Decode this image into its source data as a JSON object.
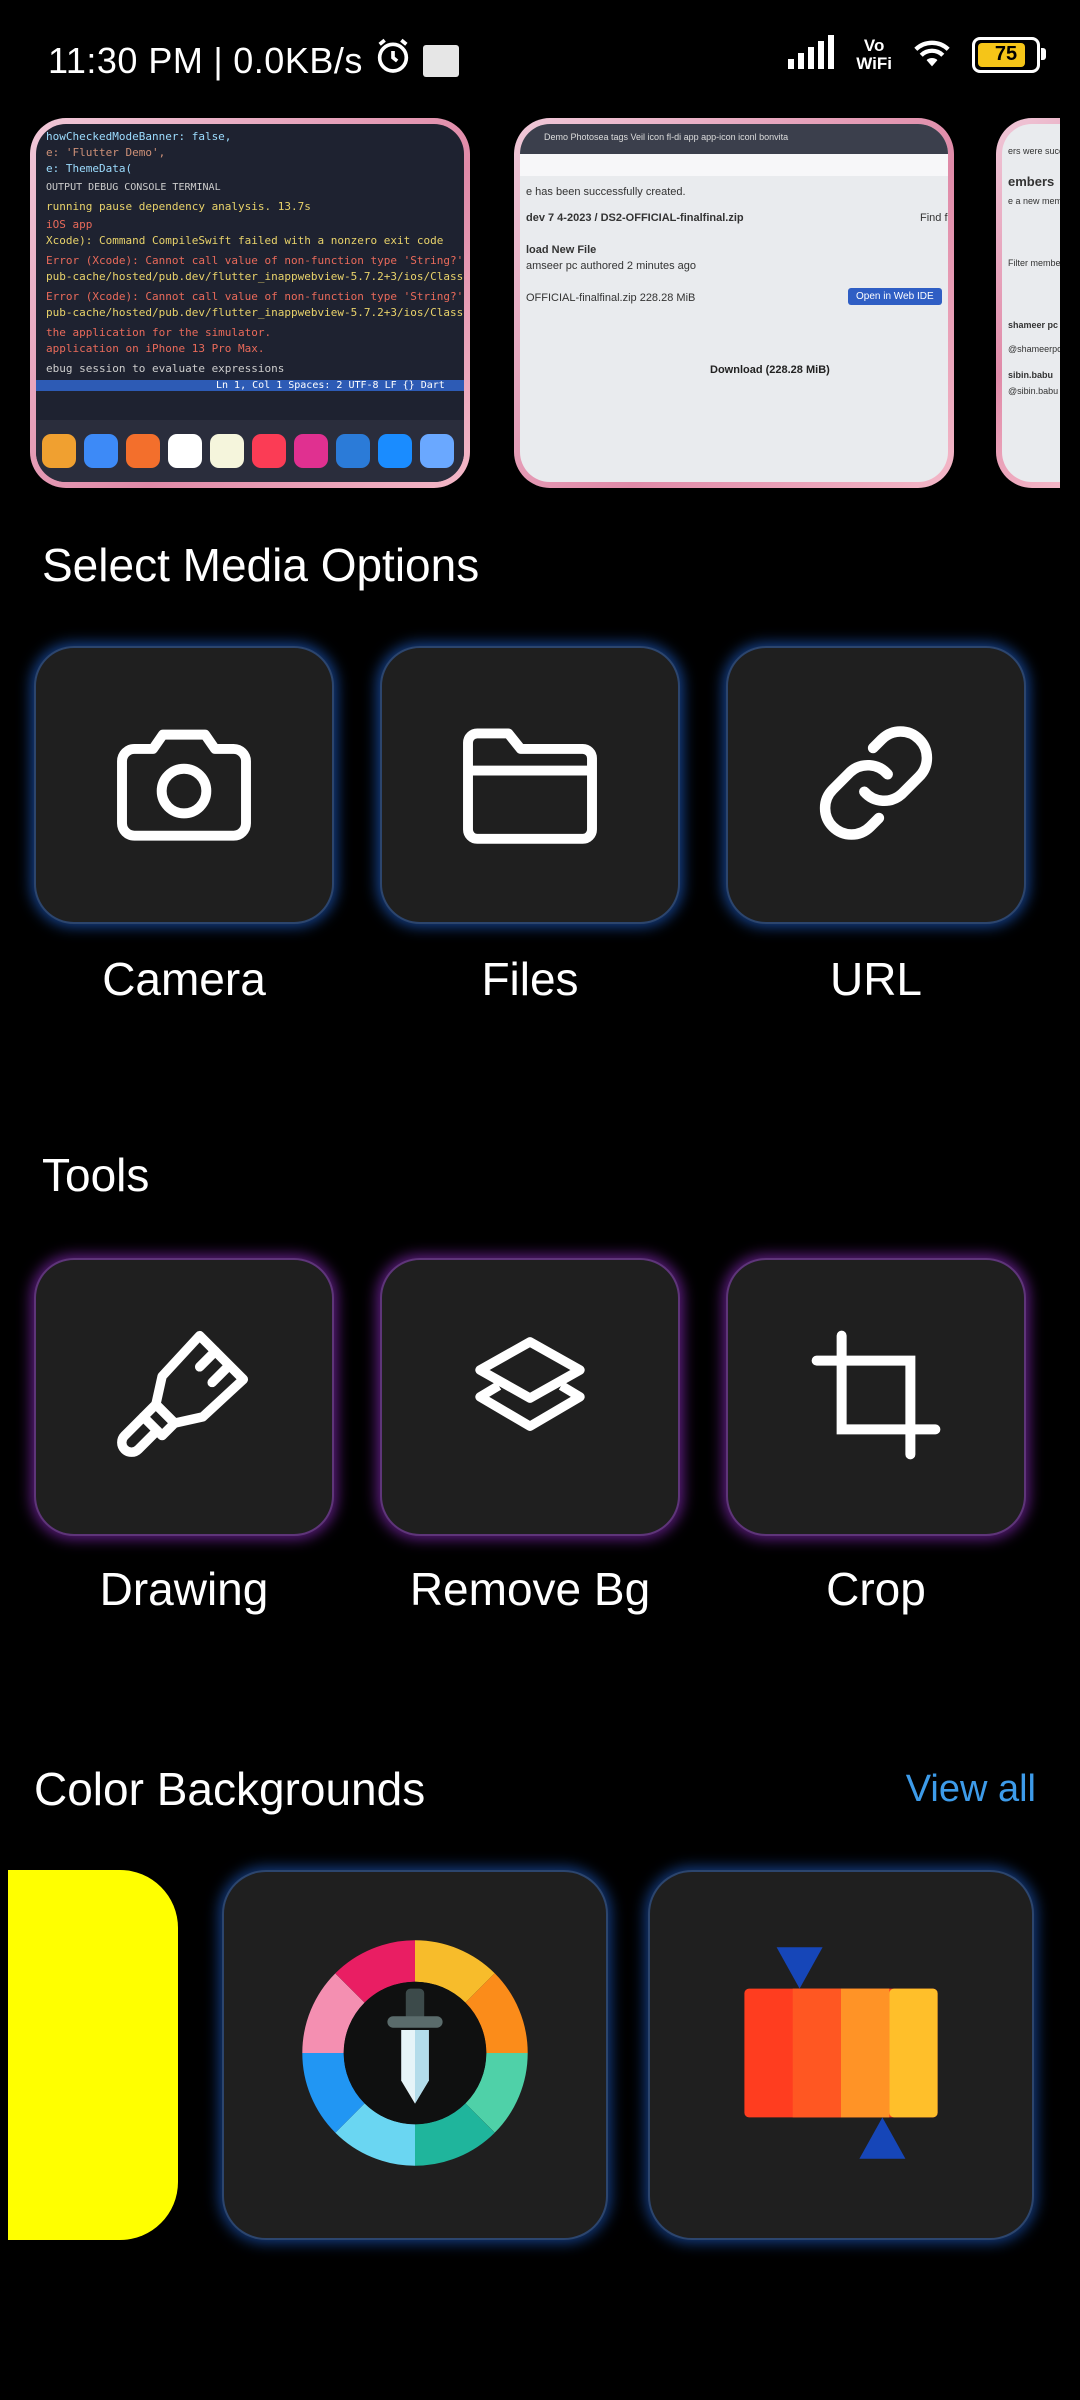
{
  "status_bar": {
    "time": "11:30 PM",
    "separator": "|",
    "network_speed": "0.0KB/s",
    "vowifi_top": "Vo",
    "vowifi_bottom": "WiFi",
    "battery_level": "75"
  },
  "recent_media": [
    {
      "name": "code-screenshot",
      "lines": [
        "howCheckedModeBanner: false,",
        "e: 'Flutter Demo',",
        "e: ThemeData(",
        "OUTPUT   DEBUG CONSOLE   TERMINAL",
        "running pause dependency analysis.            13.7s",
        "iOS app",
        "Xcode): Command CompileSwift failed with a nonzero exit code",
        "Error (Xcode): Cannot call value of non-function type 'String?'",
        "pub-cache/hosted/pub.dev/flutter_inappwebview-5.7.2+3/ios/Classes/MyCookieManager",
        "Error (Xcode): Cannot call value of non-function type 'String?'",
        "pub-cache/hosted/pub.dev/flutter_inappwebview-5.7.2+3/ios/Classes/MyCookieManager",
        "the application for the simulator.",
        "application on iPhone 13 Pro Max.",
        "ebug session to evaluate expressions",
        "Ln 1, Col 1   Spaces: 2   UTF-8   LF   {} Dart"
      ]
    },
    {
      "name": "web-screenshot",
      "tabs": "Demo   Photosea   tags   Veil   icon   fl-di   app   app-icon   iconl   bonvita",
      "lines": [
        "e has been successfully created.",
        "dev 7 4-2023 / DS2-OFFICIAL-finalfinal.zip",
        "Find fi",
        "load New File",
        "amseer pc authored 2 minutes ago",
        "OFFICIAL-finalfinal.zip   228.28 MiB",
        "Open in Web IDE",
        "Download (228.28 MiB)"
      ]
    },
    {
      "name": "members-screenshot",
      "lines": [
        "ers were succ",
        "embers",
        "e a new membe",
        "Filter members",
        "shameer pc",
        "@shameerpc",
        "sibin.babu",
        "@sibin.babu"
      ]
    }
  ],
  "media_options": {
    "title": "Select Media Options",
    "items": [
      {
        "label": "Camera",
        "icon": "camera-icon"
      },
      {
        "label": "Files",
        "icon": "folder-icon"
      },
      {
        "label": "URL",
        "icon": "link-icon"
      }
    ]
  },
  "tools": {
    "title": "Tools",
    "items": [
      {
        "label": "Drawing",
        "icon": "brush-icon"
      },
      {
        "label": "Remove Bg",
        "icon": "layers-icon"
      },
      {
        "label": "Crop",
        "icon": "crop-icon"
      }
    ]
  },
  "color_backgrounds": {
    "title": "Color Backgrounds",
    "view_all": "View all",
    "swatch_color": "#FFFF00",
    "items": [
      {
        "icon": "color-picker-wheel-icon"
      },
      {
        "icon": "color-gradient-palette-icon"
      }
    ]
  },
  "colors": {
    "accent_blue": "#3D9BE9",
    "tile_bg": "#1F1F1F",
    "media_glow": "#2878FF",
    "tools_glow": "#A032DC"
  }
}
